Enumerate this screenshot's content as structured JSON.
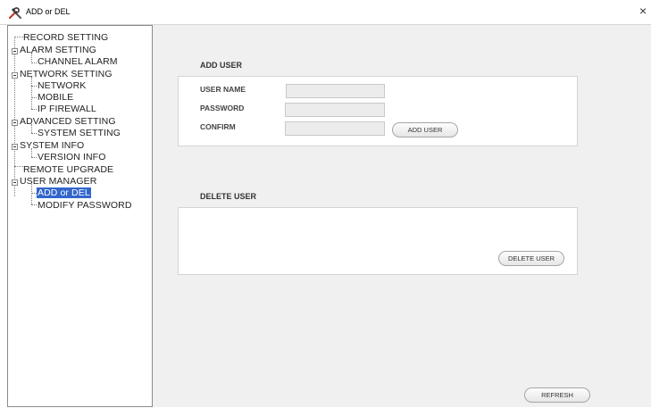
{
  "window": {
    "title": "ADD or DEL",
    "icon": "wrench-screwdriver-icon",
    "close_glyph": "×"
  },
  "tree": {
    "items": [
      {
        "label": "RECORD SETTING"
      },
      {
        "label": "ALARM SETTING"
      },
      {
        "label": "CHANNEL ALARM"
      },
      {
        "label": "NETWORK SETTING"
      },
      {
        "label": "NETWORK"
      },
      {
        "label": "MOBILE"
      },
      {
        "label": "IP FIREWALL"
      },
      {
        "label": "ADVANCED SETTING"
      },
      {
        "label": "SYSTEM SETTING"
      },
      {
        "label": "SYSTEM INFO"
      },
      {
        "label": "VERSION INFO"
      },
      {
        "label": "REMOTE UPGRADE"
      },
      {
        "label": "USER MANAGER"
      },
      {
        "label": "ADD or DEL",
        "selected": true
      },
      {
        "label": "MODIFY PASSWORD"
      }
    ],
    "selection_color": "#3366cc"
  },
  "add_user": {
    "title": "ADD USER",
    "user_name_label": "USER NAME",
    "password_label": "PASSWORD",
    "confirm_label": "CONFIRM",
    "user_name_value": "",
    "password_value": "",
    "confirm_value": "",
    "button": "ADD USER"
  },
  "delete_user": {
    "title": "DELETE USER",
    "button": "DELETE USER"
  },
  "footer": {
    "refresh": "REFRESH"
  }
}
